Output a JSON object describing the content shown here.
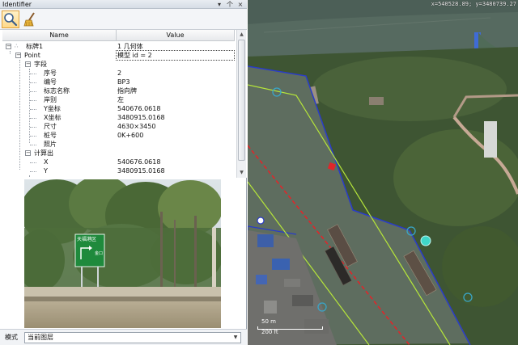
{
  "panel": {
    "title": "Identifier",
    "controls": {
      "dropdown": "▾",
      "pin": "个",
      "close": "×"
    },
    "toolbar": {
      "identify_icon": "magnifier-icon",
      "clear_icon": "broom-icon"
    }
  },
  "grid": {
    "headers": {
      "name": "Name",
      "value": "Value"
    },
    "rows": [
      {
        "indent": 0,
        "toggle": "⊟",
        "name": "标牌1",
        "value": "1 几何体"
      },
      {
        "indent": 1,
        "toggle": "⊟",
        "name": "Point",
        "value": "模型 id = 2"
      },
      {
        "indent": 2,
        "toggle": "⊟",
        "name": "字段",
        "value": ""
      },
      {
        "indent": 3,
        "toggle": "",
        "name": "序号",
        "value": "2"
      },
      {
        "indent": 3,
        "toggle": "",
        "name": "编号",
        "value": "BP3"
      },
      {
        "indent": 3,
        "toggle": "",
        "name": "标志名称",
        "value": "指向牌"
      },
      {
        "indent": 3,
        "toggle": "",
        "name": "岸别",
        "value": "左"
      },
      {
        "indent": 3,
        "toggle": "",
        "name": "Y坐标",
        "value": "540676.0618"
      },
      {
        "indent": 3,
        "toggle": "",
        "name": "X坐标",
        "value": "3480915.0168"
      },
      {
        "indent": 3,
        "toggle": "",
        "name": "尺寸",
        "value": "4630×3450"
      },
      {
        "indent": 3,
        "toggle": "",
        "name": "桩号",
        "value": "0K+600"
      },
      {
        "indent": 3,
        "toggle": "",
        "name": "照片",
        "value": ""
      },
      {
        "indent": 2,
        "toggle": "⊟",
        "name": "计算出",
        "value": ""
      },
      {
        "indent": 3,
        "toggle": "",
        "name": "X",
        "value": "540676.0618"
      },
      {
        "indent": 3,
        "toggle": "",
        "name": "Y",
        "value": "3480915.0168"
      }
    ]
  },
  "photo": {
    "sign_text_top": "天福港区",
    "sign_text_mid": "金口"
  },
  "mode": {
    "label": "模式",
    "selected": "当前图层"
  },
  "map": {
    "coordinate_readout": "x=540528.89; y=3480739.27",
    "scale": {
      "top_label": "50 m",
      "bottom_label": "200 ft"
    },
    "colors": {
      "river": "#5f6f62",
      "bank_line": "#2a3cc9",
      "center_line": "#e0262a",
      "lane_line": "#b6e63a"
    }
  }
}
